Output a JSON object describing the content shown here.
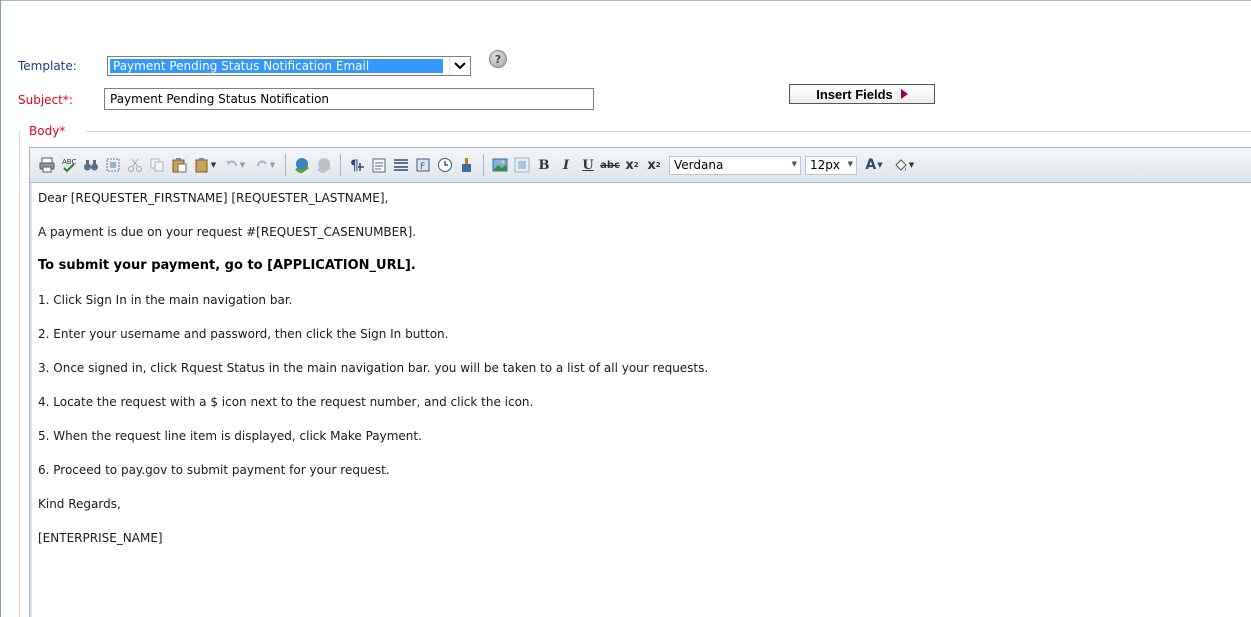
{
  "form": {
    "template_label": "Template:",
    "template_value": "Payment Pending Status Notification Email",
    "subject_label": "Subject*:",
    "subject_value": "Payment Pending Status Notification",
    "insert_fields_label": "Insert Fields",
    "body_label": "Body*"
  },
  "toolbar": {
    "font_family": "Verdana",
    "font_size": "12px"
  },
  "body_content": {
    "lines": [
      "Dear [REQUESTER_FIRSTNAME] [REQUESTER_LASTNAME],",
      "A payment is due on your request #[REQUEST_CASENUMBER].",
      "To submit your payment, go to [APPLICATION_URL].",
      "1. Click Sign In in the main navigation bar.",
      "2. Enter your username and password, then click the Sign In button.",
      "3. Once signed in, click Rquest Status in the main navigation bar. you will be taken to a list of all your requests.",
      "4. Locate the request with a $ icon next to the request number, and click the icon.",
      "5. When the request line item is displayed, click Make Payment.",
      "6. Proceed to pay.gov to submit payment for your request.",
      "Kind Regards,",
      "[ENTERPRISE_NAME]"
    ]
  },
  "colors": {
    "label_blue": "#1b3f8f",
    "label_required_red": "#e8001c",
    "selection_blue": "#3399ff"
  }
}
